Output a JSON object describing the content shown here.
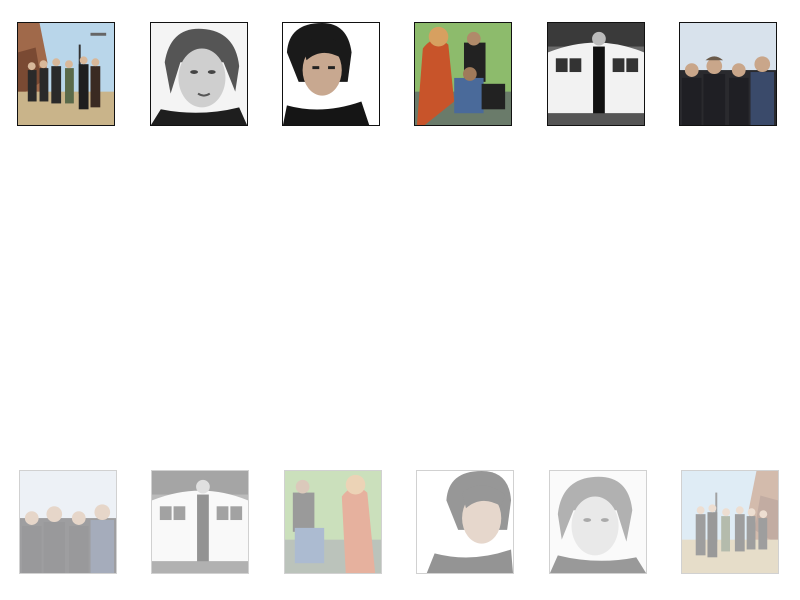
{
  "gallery": {
    "top_row": [
      {
        "photo": "band-group-desert-road"
      },
      {
        "photo": "portrait-blond-man-bw"
      },
      {
        "photo": "portrait-dark-hair-man"
      },
      {
        "photo": "band-group-green-wall"
      },
      {
        "photo": "man-with-airplane-bw"
      },
      {
        "photo": "band-group-outdoor"
      }
    ],
    "bottom_row": [
      {
        "photo": "band-group-outdoor",
        "faded": true
      },
      {
        "photo": "man-with-airplane-bw",
        "faded": true
      },
      {
        "photo": "band-group-green-wall",
        "faded": true
      },
      {
        "photo": "portrait-dark-hair-man",
        "faded": true
      },
      {
        "photo": "portrait-blond-man-bw",
        "faded": true
      },
      {
        "photo": "band-group-desert-road",
        "faded": true
      }
    ]
  },
  "colors": {
    "background": "#ffffff",
    "thumb_border": "#111111",
    "faded_border": "#9a9a9a"
  }
}
